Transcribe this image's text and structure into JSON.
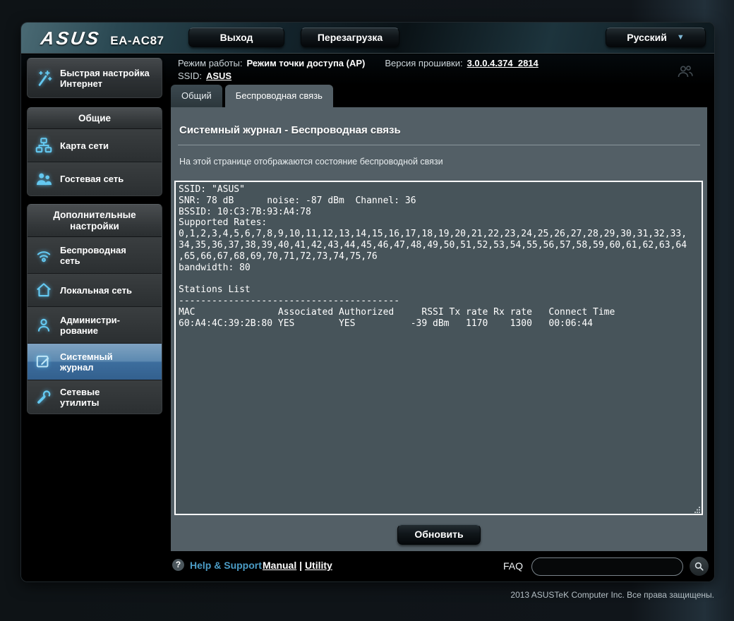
{
  "header": {
    "brand": "ASUS",
    "model": "EA-AC87",
    "logout_label": "Выход",
    "reboot_label": "Перезагрузка",
    "language": "Русский",
    "dropdown_arrow": "▼",
    "mode_label": "Режим работы:",
    "mode_value": "Режим точки доступа (AP)",
    "firmware_label": "Версия прошивки:",
    "firmware_value": "3.0.0.4.374_2814",
    "ssid_label": "SSID:",
    "ssid_value": "ASUS"
  },
  "sidebar": {
    "quick_setup_label": "Быстрая настройка Интернет",
    "groups": [
      {
        "title": "Общие",
        "items": [
          {
            "label": "Карта сети"
          },
          {
            "label": "Гостевая сеть"
          }
        ]
      },
      {
        "title": "Дополнительные настройки",
        "items": [
          {
            "label": "Беспроводная сеть"
          },
          {
            "label": "Локальная сеть"
          },
          {
            "label": "Администри-рование"
          },
          {
            "label": "Системный журнал"
          },
          {
            "label": "Сетевые утилиты"
          }
        ]
      }
    ]
  },
  "tabs": [
    {
      "label": "Общий"
    },
    {
      "label": "Беспроводная связь"
    }
  ],
  "main": {
    "title": "Системный журнал - Беспроводная связь",
    "description": "На этой странице отображаются состояние беспроводной связи",
    "log_text": "SSID: \"ASUS\"\nSNR: 78 dB      noise: -87 dBm  Channel: 36\nBSSID: 10:C3:7B:93:A4:78\nSupported Rates:\n0,1,2,3,4,5,6,7,8,9,10,11,12,13,14,15,16,17,18,19,20,21,22,23,24,25,26,27,28,29,30,31,32,33,\n34,35,36,37,38,39,40,41,42,43,44,45,46,47,48,49,50,51,52,53,54,55,56,57,58,59,60,61,62,63,64\n,65,66,67,68,69,70,71,72,73,74,75,76\nbandwidth: 80\n\nStations List\n----------------------------------------\nMAC               Associated Authorized     RSSI Tx rate Rx rate   Connect Time\n60:A4:4C:39:2B:80 YES        YES          -39 dBm   1170    1300   00:06:44",
    "refresh_label": "Обновить"
  },
  "footer": {
    "help_icon": "?",
    "help_label": "Help & Support",
    "manual_label": "Manual",
    "separator": "|",
    "utility_label": "Utility",
    "faq_label": "FAQ",
    "faq_value": ""
  },
  "copyright": "2013  ASUSTeK Computer Inc. Все права защищены.",
  "colors": {
    "accent_cyan": "#64c8f0",
    "active_item_blue": "#4b7dad",
    "panel_bg": "#535f66",
    "log_bg": "#47545a",
    "help_link_blue": "#4b9cc6"
  }
}
